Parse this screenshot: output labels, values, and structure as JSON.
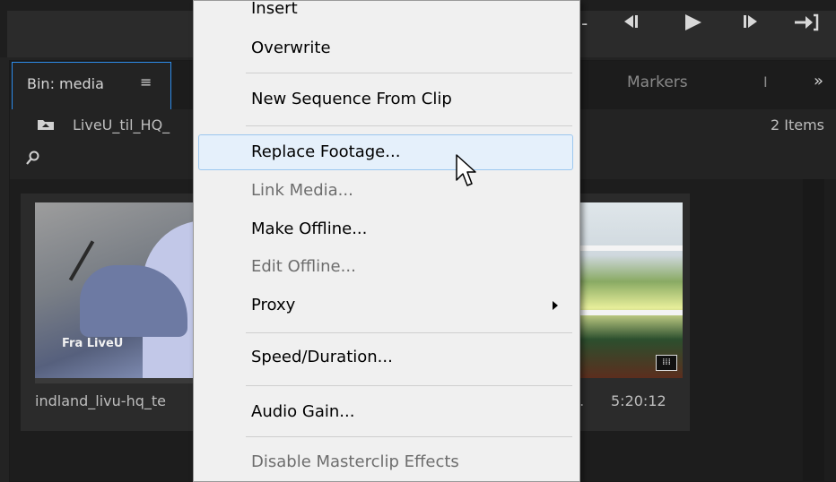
{
  "transport": {
    "icons": [
      "step-back-icon",
      "play-icon",
      "step-forward-icon",
      "go-to-out-icon"
    ]
  },
  "panel": {
    "active_tab": "Bin: media",
    "active_tab_menu": "≡",
    "markers_tab": "Markers",
    "clipped_tab": "I",
    "overflow": "»",
    "path": "LiveU_til_HQ_",
    "item_count": "2 Items",
    "search_placeholder": ""
  },
  "clips": [
    {
      "name": "indland_livu-hq_te",
      "thumb_label": "Fra LiveU",
      "progress": 0
    },
    {
      "name": "..",
      "duration": "5:20:12",
      "badge_icon": "audio-video-icon"
    }
  ],
  "context_menu": {
    "items": [
      {
        "label": "Insert",
        "disabled": false
      },
      {
        "label": "Overwrite",
        "disabled": false
      },
      {
        "label": "New Sequence From Clip",
        "disabled": false
      },
      {
        "label": "Replace Footage...",
        "disabled": false,
        "hovered": true
      },
      {
        "label": "Link Media...",
        "disabled": true
      },
      {
        "label": "Make Offline...",
        "disabled": false
      },
      {
        "label": "Edit Offline...",
        "disabled": true
      },
      {
        "label": "Proxy",
        "disabled": false,
        "submenu": true
      },
      {
        "label": "Speed/Duration...",
        "disabled": false
      },
      {
        "label": "Audio Gain...",
        "disabled": false
      },
      {
        "label": "Disable Masterclip Effects",
        "disabled": true
      }
    ]
  },
  "colors": {
    "accent": "#2d8ceb",
    "menu_bg": "#f0f0f0",
    "menu_hover": "#e5f0fb",
    "panel_bg": "#232323"
  }
}
